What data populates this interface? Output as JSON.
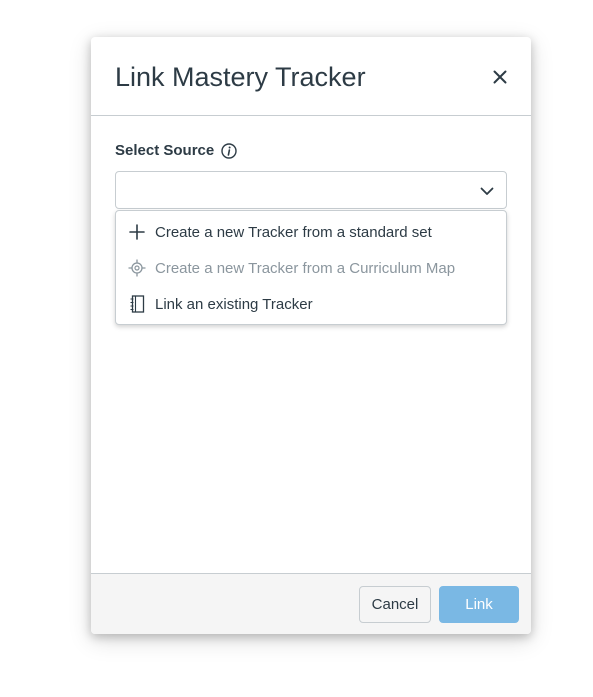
{
  "modal": {
    "title": "Link Mastery Tracker",
    "close_icon": "close-icon"
  },
  "source_field": {
    "label": "Select Source",
    "info_icon": "info-icon",
    "value": "",
    "chevron_icon": "chevron-down-icon"
  },
  "menu": {
    "items": [
      {
        "label": "Create a new Tracker from a standard set",
        "icon": "plus-icon",
        "disabled": false
      },
      {
        "label": "Create a new Tracker from a Curriculum Map",
        "icon": "target-icon",
        "disabled": true
      },
      {
        "label": "Link an existing Tracker",
        "icon": "notebook-icon",
        "disabled": false
      }
    ]
  },
  "footer": {
    "cancel_label": "Cancel",
    "link_label": "Link",
    "link_color": "#7ab8e4"
  }
}
